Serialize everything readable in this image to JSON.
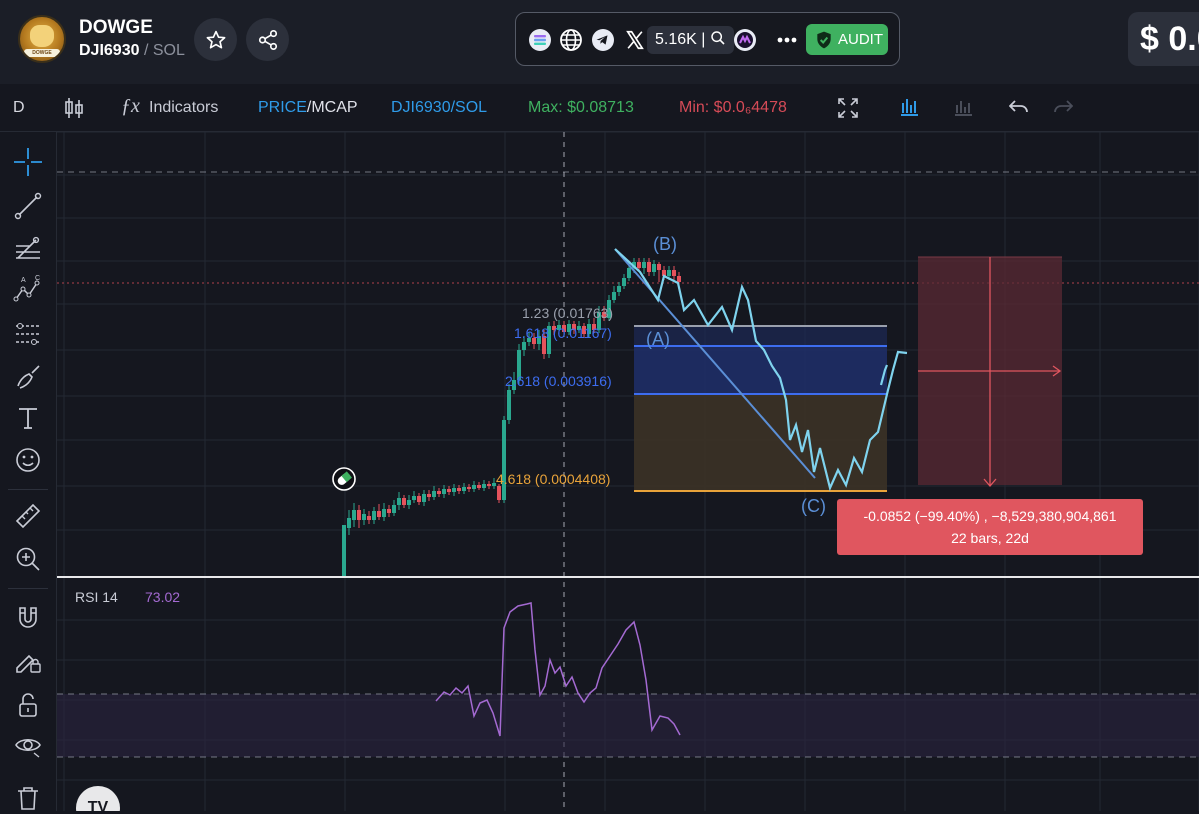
{
  "token": {
    "name": "DOWGE",
    "pair_symbol": "DJI6930",
    "pair_quote": "/ SOL",
    "logo_text": "DOWGE"
  },
  "header": {
    "follower_count": "5.16K",
    "audit_label": "AUDIT",
    "price_prefix": "$ 0.0"
  },
  "icons": [
    "star-icon",
    "share-icon",
    "solana-icon",
    "globe-icon",
    "telegram-icon",
    "x-icon",
    "search-icon",
    "dex-icon",
    "more-icon",
    "shield-check-icon"
  ],
  "toolbar": {
    "interval": "D",
    "indicators_label": "Indicators",
    "price_label": "PRICE",
    "mcap_label": "/MCAP",
    "pair_label": "DJI6930/SOL",
    "max_label": "Max: $0.08713",
    "min_label": "Min: $0.0₆4478"
  },
  "colors": {
    "accent_blue": "#2f76d6",
    "max_green": "#3fb160",
    "min_red": "#d64b57",
    "audit_green": "#3fb160",
    "rsi_purple": "#a46ad2",
    "measure_red": "#e0565f",
    "fib_orange": "#e8a33a"
  },
  "chart": {
    "wave_labels": [
      "(B)",
      "(A)",
      "(C)"
    ],
    "fib_levels": [
      {
        "label": "1.23 (0.01763)"
      },
      {
        "label": "1.618 (0.01167)"
      },
      {
        "label": "2.618 (0.003916)"
      },
      {
        "label": "4.618 (0.0004408)"
      }
    ],
    "measure": {
      "line1": "-0.0852 (−99.40%) , −8,529,380,904,861",
      "line2": "22 bars, 22d"
    },
    "rsi": {
      "label": "RSI 14",
      "value": "73.02"
    },
    "watermark": "TV"
  }
}
